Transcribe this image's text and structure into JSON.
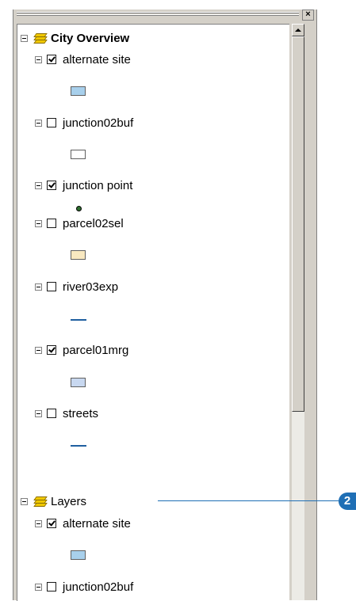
{
  "toc": {
    "groups": [
      {
        "title": "City Overview",
        "layers": [
          {
            "label": "alternate site",
            "checked": true,
            "symbol": "polygon",
            "color": "#a8d0ec"
          },
          {
            "label": "junction02buf",
            "checked": false,
            "symbol": "polygon",
            "color": "#ffffff"
          },
          {
            "label": "junction point",
            "checked": true,
            "symbol": "point",
            "color": "#2f6f2f"
          },
          {
            "label": "parcel02sel",
            "checked": false,
            "symbol": "polygon",
            "color": "#f8e8c0"
          },
          {
            "label": "river03exp",
            "checked": false,
            "symbol": "line",
            "color": "#1f5fa0"
          },
          {
            "label": "parcel01mrg",
            "checked": true,
            "symbol": "polygon",
            "color": "#c8d8f0"
          },
          {
            "label": "streets",
            "checked": false,
            "symbol": "line",
            "color": "#1f5fa0"
          }
        ]
      },
      {
        "title": "Layers",
        "layers": [
          {
            "label": "alternate site",
            "checked": true,
            "symbol": "polygon",
            "color": "#a8d0ec"
          },
          {
            "label": "junction02buf",
            "checked": false,
            "symbol": "polygon",
            "color": "#ffffff"
          }
        ]
      }
    ]
  },
  "titlebar": {
    "close_label": "×"
  },
  "callout": {
    "number": "2",
    "color": "#1f6fb5"
  }
}
